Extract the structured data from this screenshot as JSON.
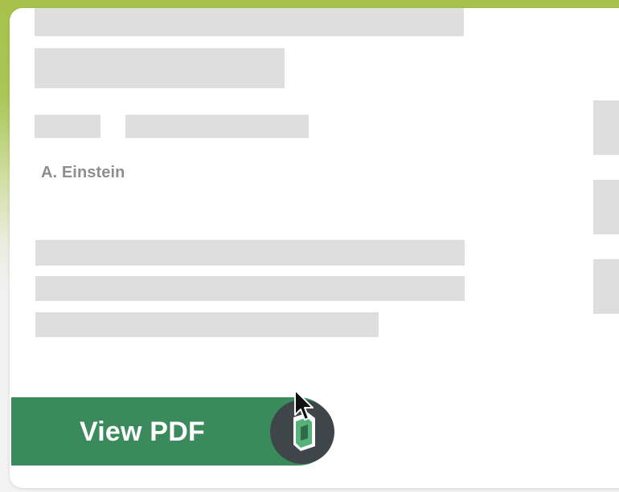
{
  "paper": {
    "author": "A. Einstein"
  },
  "actions": {
    "view_pdf_label": "View PDF"
  },
  "colors": {
    "accent_green": "#3a8a5c",
    "background_green": "#a7c24a",
    "placeholder_gray": "#dedede"
  },
  "icons": {
    "badge": "pdf-viewer-logo-icon",
    "cursor": "mouse-pointer-icon"
  }
}
